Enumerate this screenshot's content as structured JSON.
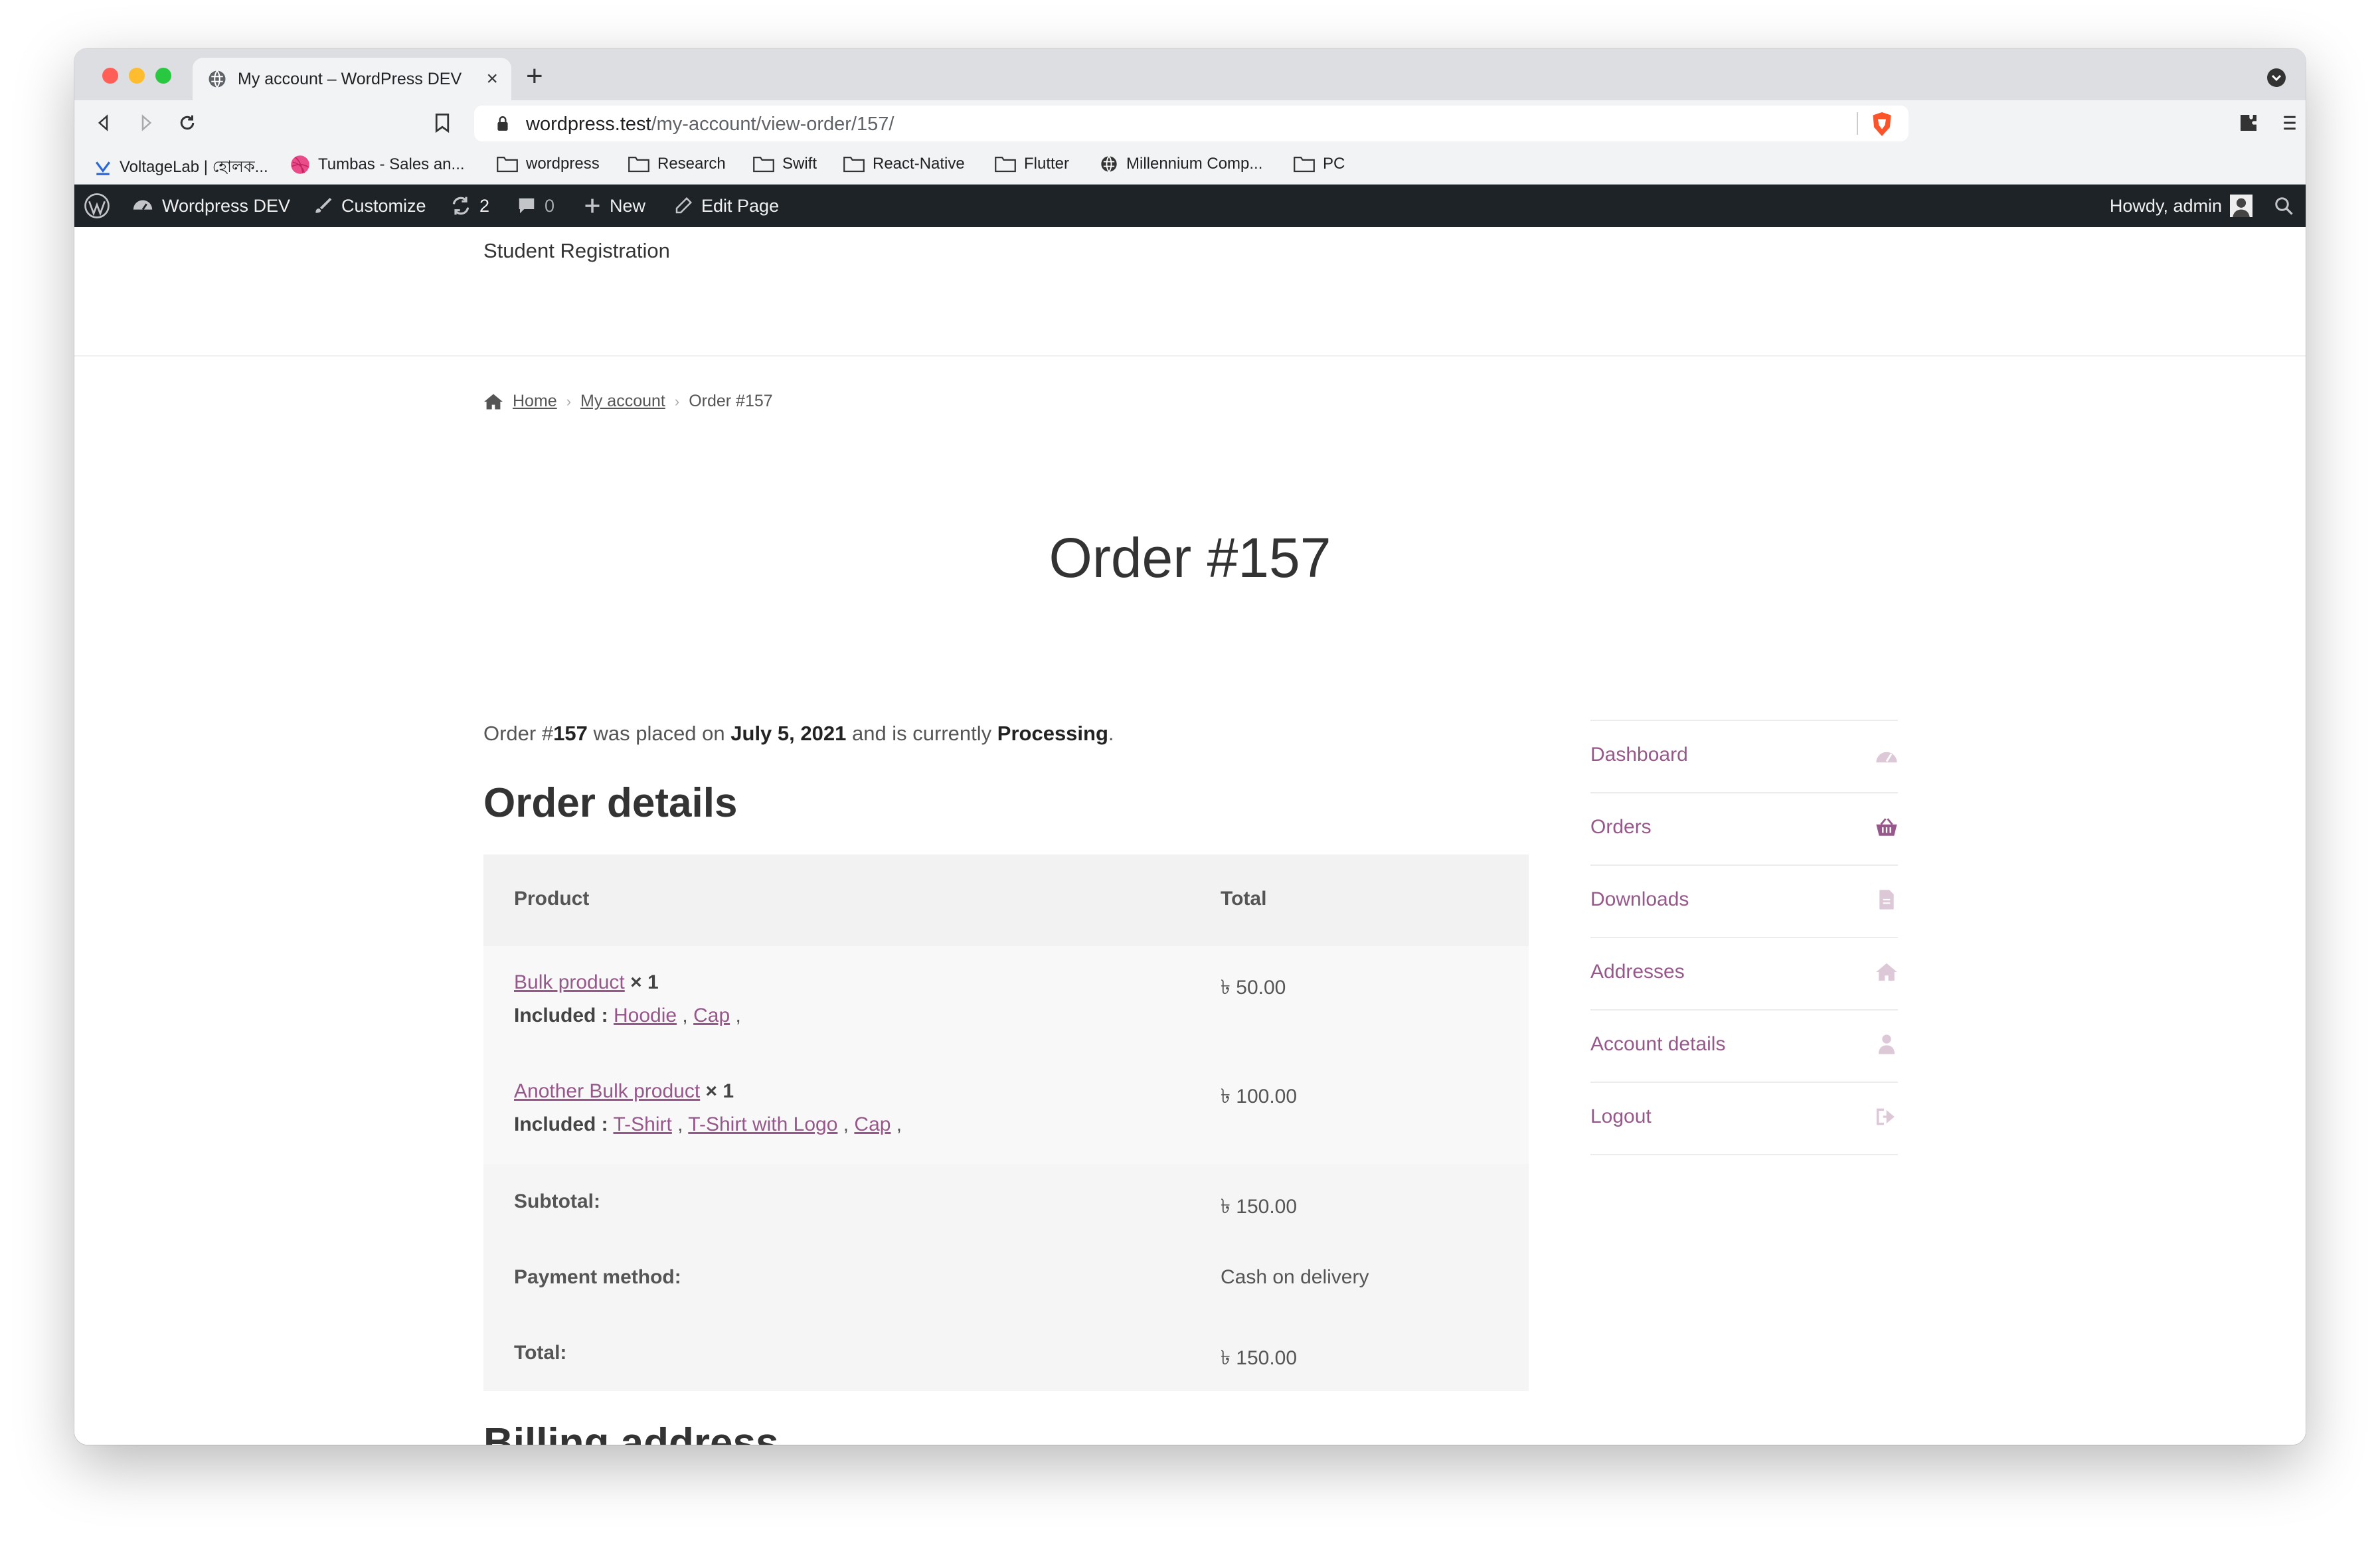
{
  "browser": {
    "tab_title": "My account – WordPress DEV",
    "tab_close": "×",
    "new_tab": "+",
    "url_host": "wordpress.test",
    "url_path": "/my-account/view-order/157/",
    "bookmarks": [
      "VoltageLab | হোলক...",
      "Tumbas - Sales an...",
      "wordpress",
      "Research",
      "Swift",
      "React-Native",
      "Flutter",
      "Millennium Comp...",
      "PC"
    ]
  },
  "adminbar": {
    "site": "Wordpress DEV",
    "customize": "Customize",
    "updates": "2",
    "comments": "0",
    "new": "New",
    "edit": "Edit Page",
    "howdy": "Howdy, admin"
  },
  "site": {
    "title": "Student Registration"
  },
  "breadcrumb": {
    "home": "Home",
    "account": "My account",
    "current": "Order #157"
  },
  "page": {
    "title": "Order #157",
    "intro": {
      "p1": "Order #",
      "num": "157",
      "p2": " was placed on ",
      "date": "July 5, 2021",
      "p3": " and is currently ",
      "status": "Processing",
      "p4": "."
    },
    "order_details_heading": "Order details",
    "billing_heading": "Billing address"
  },
  "order_table": {
    "head": {
      "product": "Product",
      "total": "Total"
    },
    "items": [
      {
        "name": "Bulk product",
        "qty": "× 1",
        "included_label": "Included :",
        "included": [
          "Hoodie",
          "Cap"
        ],
        "total": "৳ 50.00"
      },
      {
        "name": "Another Bulk product",
        "qty": "× 1",
        "included_label": "Included :",
        "included": [
          "T-Shirt",
          "T-Shirt with Logo",
          "Cap"
        ],
        "total": "৳ 100.00"
      }
    ],
    "subtotal_label": "Subtotal:",
    "subtotal": "৳ 150.00",
    "payment_label": "Payment method:",
    "payment": "Cash on delivery",
    "total_label": "Total:",
    "total": "৳ 150.00"
  },
  "account_nav": {
    "items": [
      "Dashboard",
      "Orders",
      "Downloads",
      "Addresses",
      "Account details",
      "Logout"
    ],
    "active_color": "#96588a"
  }
}
